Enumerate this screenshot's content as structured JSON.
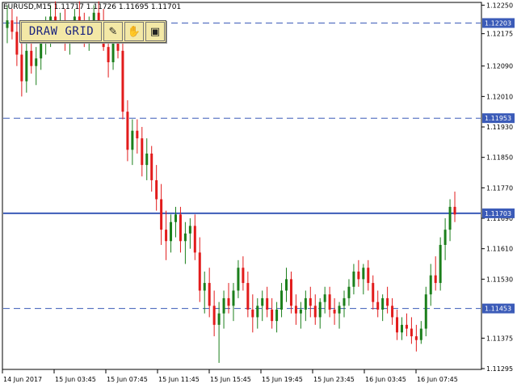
{
  "header": {
    "symbol_info": "EURUSD,M15  1.11717 1.11726 1.11695 1.11701"
  },
  "toolbar": {
    "draw_grid_label": "DRAW GRID",
    "icons": [
      "pencil-icon",
      "hand-icon",
      "computer-icon"
    ]
  },
  "colors": {
    "bull": "#1b7f1b",
    "bear": "#e21b1b",
    "line_blue": "#3b5bb8",
    "label_bg": "#3b5bb8"
  },
  "price_levels": [
    {
      "label": "1.12203",
      "value": 1.12203,
      "style": "dashed"
    },
    {
      "label": "1.11953",
      "value": 1.11953,
      "style": "dashed"
    },
    {
      "label": "1.11703",
      "value": 1.11703,
      "style": "solid"
    },
    {
      "label": "1.11453",
      "value": 1.11453,
      "style": "dashed"
    }
  ],
  "chart_data": {
    "type": "candlestick",
    "ylim": [
      1.11295,
      1.12255
    ],
    "y_ticks": [
      "1.12250",
      "1.12175",
      "1.12090",
      "1.12010",
      "1.11930",
      "1.11850",
      "1.11770",
      "1.11690",
      "1.11610",
      "1.11530",
      "1.11375",
      "1.11295"
    ],
    "x_ticks": [
      "14 Jun 2017",
      "15 Jun 03:45",
      "15 Jun 07:45",
      "15 Jun 11:45",
      "15 Jun 15:45",
      "15 Jun 19:45",
      "15 Jun 23:45",
      "16 Jun 03:45",
      "16 Jun 07:45"
    ],
    "ohlc": [
      [
        1.1219,
        1.1225,
        1.1215,
        1.1221
      ],
      [
        1.1221,
        1.1224,
        1.1216,
        1.1218
      ],
      [
        1.1218,
        1.1222,
        1.1209,
        1.1212
      ],
      [
        1.1212,
        1.1216,
        1.1201,
        1.1205
      ],
      [
        1.1205,
        1.1215,
        1.1202,
        1.1213
      ],
      [
        1.1213,
        1.1217,
        1.1207,
        1.1209
      ],
      [
        1.1209,
        1.1214,
        1.1204,
        1.1211
      ],
      [
        1.1211,
        1.1219,
        1.1208,
        1.1216
      ],
      [
        1.1216,
        1.1222,
        1.1212,
        1.1219
      ],
      [
        1.1219,
        1.1225,
        1.1214,
        1.1222
      ],
      [
        1.1222,
        1.1226,
        1.1216,
        1.1218
      ],
      [
        1.1218,
        1.1223,
        1.1215,
        1.1221
      ],
      [
        1.1221,
        1.1224,
        1.1213,
        1.1215
      ],
      [
        1.1215,
        1.1221,
        1.1212,
        1.1219
      ],
      [
        1.1219,
        1.1224,
        1.1215,
        1.1222
      ],
      [
        1.1222,
        1.1226,
        1.1217,
        1.1219
      ],
      [
        1.1219,
        1.1223,
        1.1214,
        1.1216
      ],
      [
        1.1216,
        1.1222,
        1.1213,
        1.122
      ],
      [
        1.122,
        1.1225,
        1.1216,
        1.1223
      ],
      [
        1.1223,
        1.1226,
        1.1218,
        1.1221
      ],
      [
        1.1221,
        1.1224,
        1.1213,
        1.1214
      ],
      [
        1.1214,
        1.1219,
        1.1206,
        1.121
      ],
      [
        1.121,
        1.1216,
        1.1208,
        1.1215
      ],
      [
        1.1215,
        1.1218,
        1.1211,
        1.1213
      ],
      [
        1.1213,
        1.1215,
        1.1195,
        1.1197
      ],
      [
        1.1197,
        1.12,
        1.1184,
        1.1187
      ],
      [
        1.1187,
        1.1195,
        1.1183,
        1.1192
      ],
      [
        1.1192,
        1.1195,
        1.1186,
        1.119
      ],
      [
        1.119,
        1.1193,
        1.118,
        1.1183
      ],
      [
        1.1183,
        1.119,
        1.1179,
        1.1186
      ],
      [
        1.1186,
        1.1188,
        1.1176,
        1.1179
      ],
      [
        1.1179,
        1.1183,
        1.1171,
        1.1174
      ],
      [
        1.1174,
        1.1178,
        1.1162,
        1.1166
      ],
      [
        1.1166,
        1.1171,
        1.1158,
        1.1163
      ],
      [
        1.1163,
        1.117,
        1.116,
        1.1168
      ],
      [
        1.1168,
        1.1172,
        1.1164,
        1.117
      ],
      [
        1.117,
        1.1172,
        1.116,
        1.1163
      ],
      [
        1.1163,
        1.1168,
        1.1157,
        1.1165
      ],
      [
        1.1165,
        1.1169,
        1.1161,
        1.1167
      ],
      [
        1.1167,
        1.117,
        1.1158,
        1.116
      ],
      [
        1.116,
        1.1164,
        1.1147,
        1.115
      ],
      [
        1.115,
        1.1155,
        1.1144,
        1.1152
      ],
      [
        1.1152,
        1.1156,
        1.1143,
        1.1146
      ],
      [
        1.1146,
        1.115,
        1.1138,
        1.1141
      ],
      [
        1.1141,
        1.1147,
        1.1131,
        1.1144
      ],
      [
        1.1144,
        1.115,
        1.114,
        1.1148
      ],
      [
        1.1148,
        1.1152,
        1.1144,
        1.1146
      ],
      [
        1.1146,
        1.1152,
        1.1142,
        1.115
      ],
      [
        1.115,
        1.1158,
        1.1148,
        1.1156
      ],
      [
        1.1156,
        1.1159,
        1.115,
        1.1152
      ],
      [
        1.1152,
        1.1155,
        1.1143,
        1.1145
      ],
      [
        1.1145,
        1.1149,
        1.1139,
        1.1143
      ],
      [
        1.1143,
        1.1148,
        1.114,
        1.1146
      ],
      [
        1.1146,
        1.115,
        1.1142,
        1.1148
      ],
      [
        1.1148,
        1.1151,
        1.1143,
        1.1145
      ],
      [
        1.1145,
        1.1148,
        1.114,
        1.1142
      ],
      [
        1.1142,
        1.1147,
        1.1139,
        1.1145
      ],
      [
        1.1145,
        1.1152,
        1.1143,
        1.115
      ],
      [
        1.115,
        1.1156,
        1.1147,
        1.1153
      ],
      [
        1.1153,
        1.1155,
        1.1144,
        1.1146
      ],
      [
        1.1146,
        1.1149,
        1.1141,
        1.1144
      ],
      [
        1.1144,
        1.1147,
        1.114,
        1.1145
      ],
      [
        1.1145,
        1.115,
        1.1142,
        1.1148
      ],
      [
        1.1148,
        1.1151,
        1.1143,
        1.1146
      ],
      [
        1.1146,
        1.1149,
        1.1141,
        1.1143
      ],
      [
        1.1143,
        1.1148,
        1.114,
        1.1147
      ],
      [
        1.1147,
        1.1151,
        1.1144,
        1.1149
      ],
      [
        1.1149,
        1.1151,
        1.1143,
        1.1145
      ],
      [
        1.1145,
        1.1148,
        1.1141,
        1.1144
      ],
      [
        1.1144,
        1.1147,
        1.114,
        1.1146
      ],
      [
        1.1146,
        1.115,
        1.1143,
        1.1148
      ],
      [
        1.1148,
        1.1153,
        1.1146,
        1.1151
      ],
      [
        1.1151,
        1.1157,
        1.1149,
        1.1155
      ],
      [
        1.1155,
        1.1158,
        1.1151,
        1.1153
      ],
      [
        1.1153,
        1.1157,
        1.1149,
        1.1156
      ],
      [
        1.1156,
        1.1158,
        1.115,
        1.1152
      ],
      [
        1.1152,
        1.1154,
        1.1145,
        1.1147
      ],
      [
        1.1147,
        1.115,
        1.1143,
        1.1145
      ],
      [
        1.1145,
        1.1149,
        1.1142,
        1.1148
      ],
      [
        1.1148,
        1.1151,
        1.1144,
        1.1146
      ],
      [
        1.1146,
        1.1148,
        1.1141,
        1.1143
      ],
      [
        1.1143,
        1.1145,
        1.1137,
        1.1139
      ],
      [
        1.1139,
        1.1143,
        1.1137,
        1.1141
      ],
      [
        1.1141,
        1.1144,
        1.1138,
        1.114
      ],
      [
        1.114,
        1.1143,
        1.1136,
        1.1138
      ],
      [
        1.1138,
        1.1141,
        1.1134,
        1.1137
      ],
      [
        1.1137,
        1.1142,
        1.1136,
        1.114
      ],
      [
        1.114,
        1.1151,
        1.1138,
        1.1149
      ],
      [
        1.1149,
        1.1157,
        1.1146,
        1.1154
      ],
      [
        1.1154,
        1.1159,
        1.115,
        1.1152
      ],
      [
        1.1152,
        1.1164,
        1.115,
        1.1162
      ],
      [
        1.1162,
        1.1169,
        1.1158,
        1.1166
      ],
      [
        1.1166,
        1.1174,
        1.1163,
        1.1172
      ],
      [
        1.1172,
        1.1176,
        1.1168,
        1.117
      ]
    ]
  }
}
